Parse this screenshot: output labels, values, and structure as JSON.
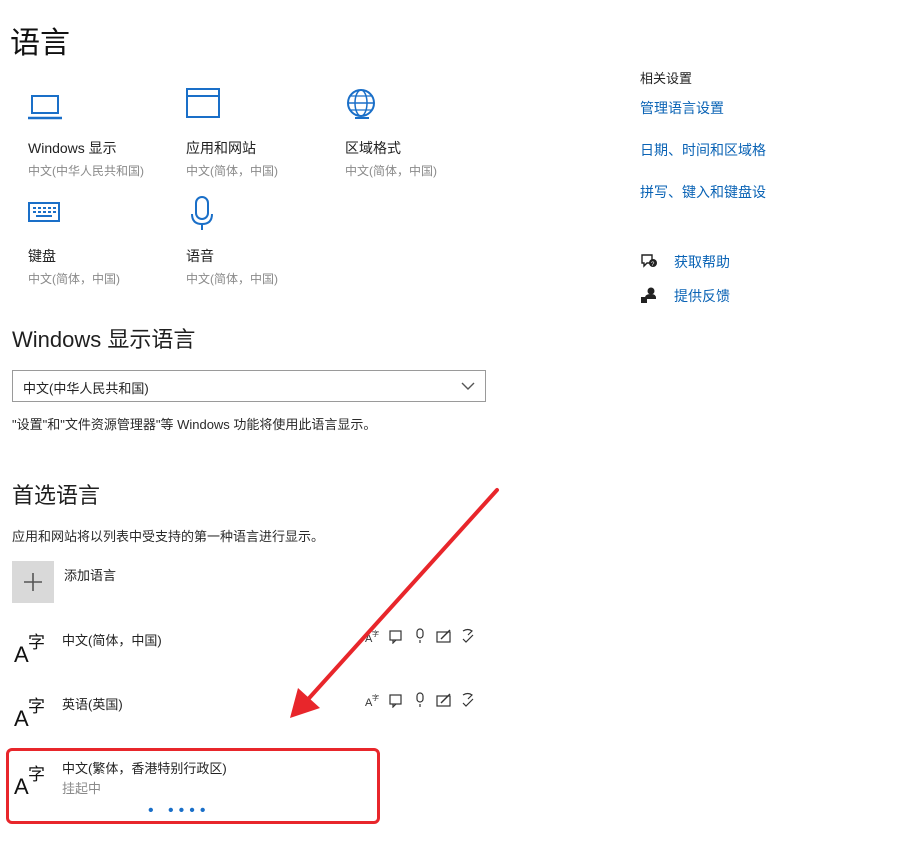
{
  "page_title": "语言",
  "tiles": [
    {
      "name": "windows-display",
      "title": "Windows 显示",
      "sub": "中文(中华人民共和国)",
      "icon": "laptop-icon"
    },
    {
      "name": "apps-websites",
      "title": "应用和网站",
      "sub": "中文(简体，中国)",
      "icon": "window-icon"
    },
    {
      "name": "regional-format",
      "title": "区域格式",
      "sub": "中文(简体，中国)",
      "icon": "globe-icon"
    },
    {
      "name": "keyboard",
      "title": "键盘",
      "sub": "中文(简体，中国)",
      "icon": "keyboard-icon"
    },
    {
      "name": "speech",
      "title": "语音",
      "sub": "中文(简体，中国)",
      "icon": "microphone-icon"
    }
  ],
  "display_language": {
    "heading": "Windows 显示语言",
    "selected": "中文(中华人民共和国)",
    "description": "\"设置\"和\"文件资源管理器\"等 Windows 功能将使用此语言显示。"
  },
  "preferred": {
    "heading": "首选语言",
    "description": "应用和网站将以列表中受支持的第一种语言进行显示。",
    "add_label": "添加语言",
    "languages": [
      {
        "name": "中文(简体，中国)",
        "status": ""
      },
      {
        "name": "英语(英国)",
        "status": ""
      },
      {
        "name": "中文(繁体，香港特别行政区)",
        "status": "挂起中"
      }
    ],
    "progress_dots": "• ••••"
  },
  "related": {
    "heading": "相关设置",
    "links": [
      "管理语言设置",
      "日期、时间和区域格",
      "拼写、键入和键盘设"
    ],
    "help": "获取帮助",
    "feedback": "提供反馈"
  },
  "colors": {
    "accent": "#0a63b5",
    "annotation": "#e8262b"
  }
}
